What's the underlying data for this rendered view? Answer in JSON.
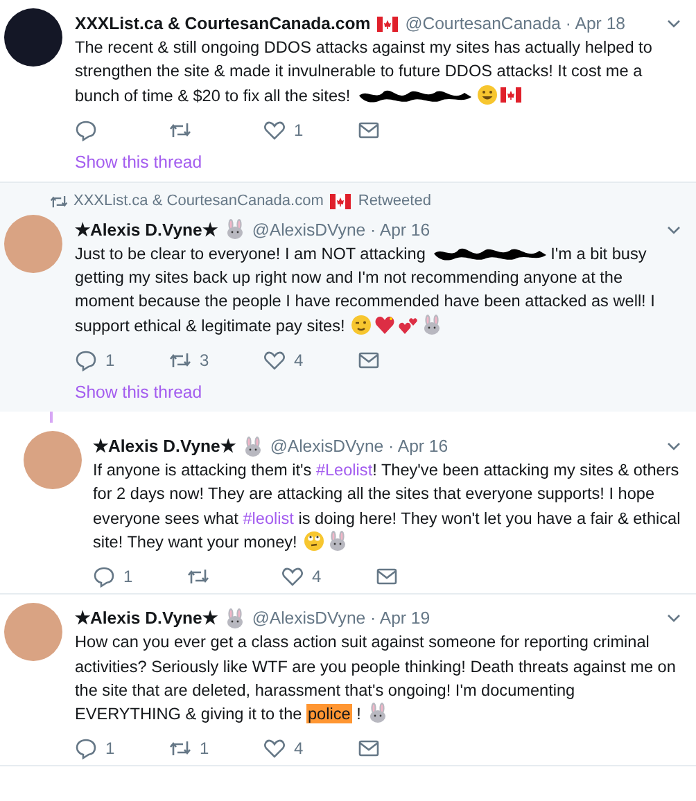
{
  "tweets": [
    {
      "highlighted": false,
      "indented": false,
      "thread_line": false,
      "avatar": {
        "kind": "logo"
      },
      "name": "XXXList.ca & CourtesanCanada.com",
      "name_icons": [
        {
          "kind": "flag"
        }
      ],
      "handle_date": "@CourtesanCanada · Apr 18",
      "body": [
        {
          "kind": "text",
          "text": "The recent & still ongoing DDOS attacks against my sites has actually helped to strengthen the site & made it invulnerable to future DDOS attacks! It cost me a bunch of time & $20 to fix all the sites! "
        },
        {
          "kind": "redacted"
        },
        {
          "kind": "smile"
        },
        {
          "kind": "flag"
        }
      ],
      "actions": {
        "likes": "1"
      },
      "show_thread": "Show this thread"
    },
    {
      "highlighted": true,
      "indented": false,
      "thread_line": true,
      "retweeted_by": {
        "name": "XXXList.ca & CourtesanCanada.com",
        "icons": [
          {
            "kind": "flag"
          }
        ],
        "label": "Retweeted"
      },
      "avatar": {
        "kind": "person"
      },
      "name": "★Alexis D.Vyne★",
      "name_icons": [
        {
          "kind": "rabbit"
        }
      ],
      "handle_date": "@AlexisDVyne · Apr 16",
      "body": [
        {
          "kind": "text",
          "text": "Just to be clear to everyone! I am NOT attacking "
        },
        {
          "kind": "redacted"
        },
        {
          "kind": "text",
          "text": "I'm a bit busy getting my sites back up right now and I'm not recommending anyone at the moment because the people I have recommended have been attacked as well! I support ethical & legitimate pay sites! "
        },
        {
          "kind": "wink"
        },
        {
          "kind": "heart"
        },
        {
          "kind": "hearts"
        },
        {
          "kind": "rabbit"
        }
      ],
      "actions": {
        "replies": "1",
        "retweets": "3",
        "likes": "4"
      },
      "show_thread": "Show this thread"
    },
    {
      "highlighted": false,
      "indented": true,
      "thread_line": false,
      "avatar": {
        "kind": "person"
      },
      "name": "★Alexis D.Vyne★",
      "name_icons": [
        {
          "kind": "rabbit"
        }
      ],
      "handle_date": "@AlexisDVyne · Apr 16",
      "body": [
        {
          "kind": "text",
          "text": "If anyone is attacking them it's "
        },
        {
          "kind": "hashtag",
          "text": "#Leolist"
        },
        {
          "kind": "text",
          "text": "! They've been attacking my sites & others for 2 days now! They are attacking all the sites that everyone supports! I hope everyone sees what "
        },
        {
          "kind": "hashtag",
          "text": "#leolist"
        },
        {
          "kind": "text",
          "text": " is doing here! They won't let you have a fair & ethical site! They want your money! "
        },
        {
          "kind": "eyeroll"
        },
        {
          "kind": "rabbit"
        }
      ],
      "actions": {
        "replies": "1",
        "likes": "4"
      }
    },
    {
      "highlighted": false,
      "indented": false,
      "thread_line": false,
      "avatar": {
        "kind": "person"
      },
      "name": "★Alexis D.Vyne★",
      "name_icons": [
        {
          "kind": "rabbit"
        }
      ],
      "handle_date": "@AlexisDVyne · Apr 19",
      "body": [
        {
          "kind": "text",
          "text": "How can you ever get a class action suit against someone for reporting criminal activities? Seriously like WTF are you people thinking! Death threats against me on the site that are deleted, harassment that's ongoing! I'm documenting EVERYTHING & giving it to the "
        },
        {
          "kind": "highlight",
          "text": "police"
        },
        {
          "kind": "text",
          "text": " ! "
        },
        {
          "kind": "rabbit"
        }
      ],
      "actions": {
        "replies": "1",
        "retweets": "1",
        "likes": "4"
      }
    }
  ]
}
